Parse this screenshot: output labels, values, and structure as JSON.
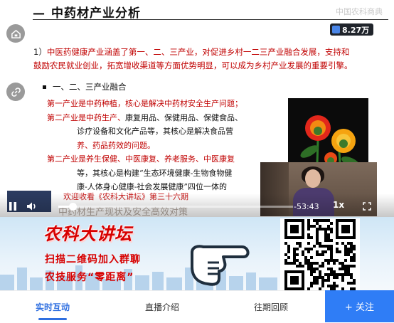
{
  "slide": {
    "title": "中药材产业分析",
    "brand_watermark": "中国农科商典",
    "views": "8.27万",
    "intro_number": "1）",
    "intro_text": "中医药健康产业涵盖了第一、二、三产业，对促进乡村一二三产业融合发展，支持和鼓励农民就业创业，拓宽增收渠道等方面优势明显，可以成为乡村产业发展的重要引擎。",
    "bullet": "一、二、三产业融合",
    "lines": [
      {
        "lead": "第一产业是中药种植，",
        "rest": "核心是解决中药材安全生产问题；"
      },
      {
        "lead": "第二产业是中药生产、",
        "rest": "康复用品、保健用品、保健食品、"
      },
      {
        "lead": "",
        "rest": "诊疗设备和文化产品等，其核心是解决食品营"
      },
      {
        "lead": "",
        "rest": "养、药品药效的问题。"
      },
      {
        "lead": "第二产业是养生保健、",
        "rest": "中医康复、养老服务、中医康复"
      },
      {
        "lead": "",
        "rest": "等，其核心是构建“生态环境健康-生物食物健"
      },
      {
        "lead": "",
        "rest": "康-人体身心健康-社会发展健康”四位一体的"
      }
    ],
    "caption": "欢迎收看《农科大讲坛》第三十六期",
    "lower_title": "中药材生产现状及安全高效对策"
  },
  "player": {
    "time": "-53:43",
    "speed": "1x",
    "progress": 0.06
  },
  "banner": {
    "title": "农科大讲坛",
    "line1": "扫描二维码加入群聊",
    "line2": "农技服务“零距离”"
  },
  "tabs": [
    "实时互动",
    "直播介绍",
    "往期回顾"
  ],
  "follow_label": "+ 关注",
  "colors": {
    "accent": "#2f7df6",
    "slide_red": "#c00000",
    "banner_red": "#d70000"
  }
}
